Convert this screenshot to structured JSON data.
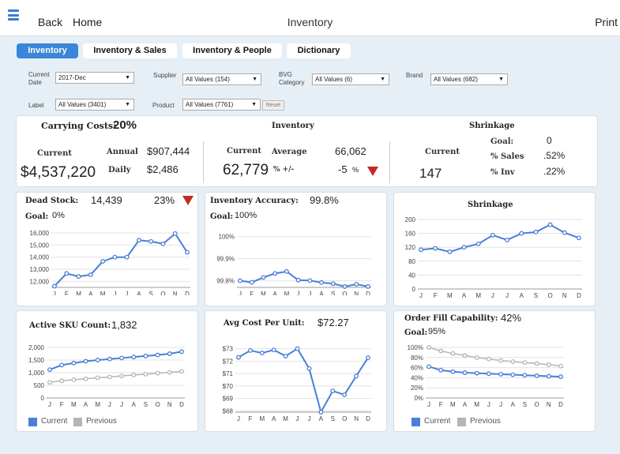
{
  "topbar": {
    "back": "Back",
    "home": "Home",
    "title": "Inventory",
    "print": "Print"
  },
  "tabs": [
    "Inventory",
    "Inventory & Sales",
    "Inventory & People",
    "Dictionary"
  ],
  "filters": {
    "current_date": {
      "label": "Current Date",
      "value": "2017-Dec"
    },
    "supplier": {
      "label": "Supplier",
      "value": "All Values (154)"
    },
    "bvg_category": {
      "label": "BVG Category",
      "value": "All Values (6)"
    },
    "brand": {
      "label": "Brand",
      "value": "All Values (682)"
    },
    "label": {
      "label": "Label",
      "value": "All Values (3401)"
    },
    "product": {
      "label": "Product",
      "value": "All Values (7761)"
    },
    "reset": "Reset"
  },
  "summary": {
    "carrying_costs_label": "Carrying Costs:",
    "carrying_costs_value": "20%",
    "current_label": "Current",
    "current_value": "$4,537,220",
    "annual_label": "Annual",
    "annual_value": "$907,444",
    "daily_label": "Daily",
    "daily_value": "$2,486",
    "inventory_title": "Inventory",
    "inv_current_label": "Current",
    "inv_current_value": "62,779",
    "average_label": "Average",
    "average_value": "66,062",
    "pct_change_label": "% +/-",
    "pct_change_value": "-5",
    "pct_sign": "%",
    "shrinkage_title": "Shrinkage",
    "shr_current_label": "Current",
    "shr_current_value": "147",
    "goal_label": "Goal:",
    "goal_value": "0",
    "pct_sales_label": "% Sales",
    "pct_sales_value": ".52%",
    "pct_inv_label": "% Inv",
    "pct_inv_value": ".22%"
  },
  "cards": {
    "dead_stock": {
      "title": "Dead Stock:",
      "value": "14,439",
      "pct": "23%",
      "goal_label": "Goal:",
      "goal_value": "0%"
    },
    "inventory_accuracy": {
      "title": "Inventory Accuracy:",
      "value": "99.8%",
      "goal_label": "Goal:",
      "goal_value": "100%"
    },
    "shrinkage": {
      "title": "Shrinkage"
    },
    "active_sku": {
      "title": "Active SKU Count:",
      "value": "1,832"
    },
    "avg_cost": {
      "title": "Avg Cost Per Unit:",
      "value": "$72.27"
    },
    "order_fill": {
      "title": "Order Fill Capability:",
      "value": "42%",
      "goal_label": "Goal:",
      "goal_value": "95%"
    }
  },
  "legend": {
    "current": "Current",
    "previous": "Previous"
  },
  "colors": {
    "accent": "#3a86d8",
    "line": "#4a7fd8",
    "previous": "#b5b5b5",
    "alert": "#c62828"
  },
  "chart_data": [
    {
      "id": "dead_stock",
      "type": "line",
      "categories": [
        "J",
        "F",
        "M",
        "A",
        "M",
        "J",
        "J",
        "A",
        "S",
        "O",
        "N",
        "D"
      ],
      "ylim": [
        11500,
        16200
      ],
      "yticks": [
        12000,
        13000,
        14000,
        15000,
        16000
      ],
      "ytick_labels": [
        "12,000",
        "13,000",
        "14,000",
        "15,000",
        "16,000"
      ],
      "series": [
        {
          "values": [
            11600,
            12650,
            12400,
            12550,
            13650,
            14000,
            14000,
            15400,
            15300,
            15100,
            15950,
            14400
          ]
        }
      ]
    },
    {
      "id": "inventory_accuracy",
      "type": "line",
      "categories": [
        "J",
        "F",
        "M",
        "A",
        "M",
        "J",
        "J",
        "A",
        "S",
        "O",
        "N",
        "D"
      ],
      "ylim": [
        99.77,
        100.02
      ],
      "yticks": [
        99.8,
        99.9,
        100.0
      ],
      "ytick_labels": [
        "99.8%",
        "99.9%",
        "100%"
      ],
      "series": [
        {
          "values": [
            99.8,
            99.793,
            99.815,
            99.833,
            99.842,
            99.803,
            99.801,
            99.792,
            99.787,
            99.774,
            99.784,
            99.774
          ]
        }
      ]
    },
    {
      "id": "shrinkage",
      "type": "line",
      "categories": [
        "J",
        "F",
        "M",
        "A",
        "M",
        "J",
        "J",
        "A",
        "S",
        "O",
        "N",
        "D"
      ],
      "ylim": [
        0,
        200
      ],
      "yticks": [
        0,
        40,
        80,
        120,
        160,
        200
      ],
      "ytick_labels": [
        "0",
        "40",
        "80",
        "120",
        "160",
        "200"
      ],
      "series": [
        {
          "values": [
            113,
            117,
            107,
            120,
            130,
            155,
            141,
            160,
            164,
            185,
            162,
            147
          ]
        }
      ]
    },
    {
      "id": "active_sku",
      "type": "line",
      "categories": [
        "J",
        "F",
        "M",
        "A",
        "M",
        "J",
        "J",
        "A",
        "S",
        "O",
        "N",
        "D"
      ],
      "ylim": [
        0,
        2000
      ],
      "yticks": [
        0,
        500,
        1000,
        1500,
        2000
      ],
      "ytick_labels": [
        "0",
        "500",
        "1,000",
        "1,500",
        "2,000"
      ],
      "series": [
        {
          "name": "Current",
          "values": [
            1120,
            1300,
            1380,
            1450,
            1500,
            1540,
            1580,
            1620,
            1660,
            1700,
            1750,
            1832
          ]
        },
        {
          "name": "Previous",
          "values": [
            620,
            680,
            720,
            760,
            800,
            830,
            870,
            910,
            940,
            980,
            1010,
            1050
          ]
        }
      ]
    },
    {
      "id": "avg_cost",
      "type": "line",
      "categories": [
        "J",
        "F",
        "M",
        "A",
        "M",
        "J",
        "J",
        "A",
        "S",
        "O",
        "N",
        "D"
      ],
      "ylim": [
        67.9,
        73.1
      ],
      "yticks": [
        68,
        69,
        70,
        71,
        72,
        73
      ],
      "ytick_labels": [
        "$68",
        "$69",
        "$70",
        "$71",
        "$72",
        "$73"
      ],
      "series": [
        {
          "values": [
            72.3,
            72.85,
            72.65,
            72.9,
            72.4,
            73.0,
            71.4,
            67.9,
            69.6,
            69.3,
            70.8,
            72.27
          ]
        }
      ]
    },
    {
      "id": "order_fill",
      "type": "line",
      "categories": [
        "J",
        "F",
        "M",
        "A",
        "M",
        "J",
        "J",
        "A",
        "S",
        "O",
        "N",
        "D"
      ],
      "ylim": [
        0,
        100
      ],
      "yticks": [
        0,
        20,
        40,
        60,
        80,
        100
      ],
      "ytick_labels": [
        "0%",
        "20%",
        "40%",
        "60%",
        "80%",
        "100%"
      ],
      "series": [
        {
          "name": "Current",
          "values": [
            62,
            55,
            52,
            50,
            49,
            48,
            47,
            46,
            45,
            44,
            43,
            42
          ]
        },
        {
          "name": "Previous",
          "values": [
            100,
            93,
            88,
            84,
            80,
            77,
            74,
            72,
            70,
            68,
            66,
            63
          ]
        }
      ]
    }
  ]
}
